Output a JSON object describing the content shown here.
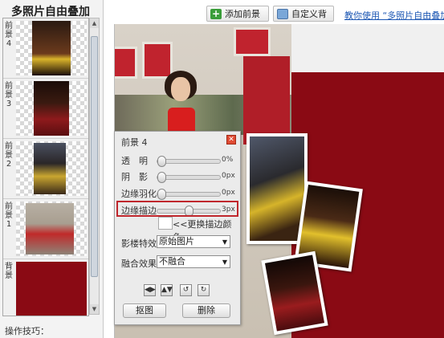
{
  "sidebar": {
    "title": "多照片自由叠加",
    "layers": [
      {
        "label": "前景4"
      },
      {
        "label": "前景3"
      },
      {
        "label": "前景2"
      },
      {
        "label": "前景1"
      },
      {
        "label": "背景"
      }
    ],
    "tips_title": "操作技巧："
  },
  "toolbar": {
    "add_foreground": "添加前景",
    "custom_background": "自定义背景",
    "tutorial_link": "教你使用 “多照片自由叠加"
  },
  "panel": {
    "title": "前景 4",
    "sliders": [
      {
        "label": "透　明",
        "value": "0%"
      },
      {
        "label": "阴　影",
        "value": "0px"
      },
      {
        "label": "边缘羽化",
        "value": "0px"
      },
      {
        "label": "边缘描边",
        "value": "3px"
      }
    ],
    "color_link": "<<更换描边颜色",
    "effect_label": "影楼特效",
    "effect_value": "原始图片",
    "blend_label": "融合效果",
    "blend_value": "不融合",
    "cutout_button": "抠图",
    "delete_button": "删除"
  },
  "colors": {
    "background_red": "#8a0a14",
    "highlight": "#c0272d",
    "link": "#1b56b3"
  }
}
